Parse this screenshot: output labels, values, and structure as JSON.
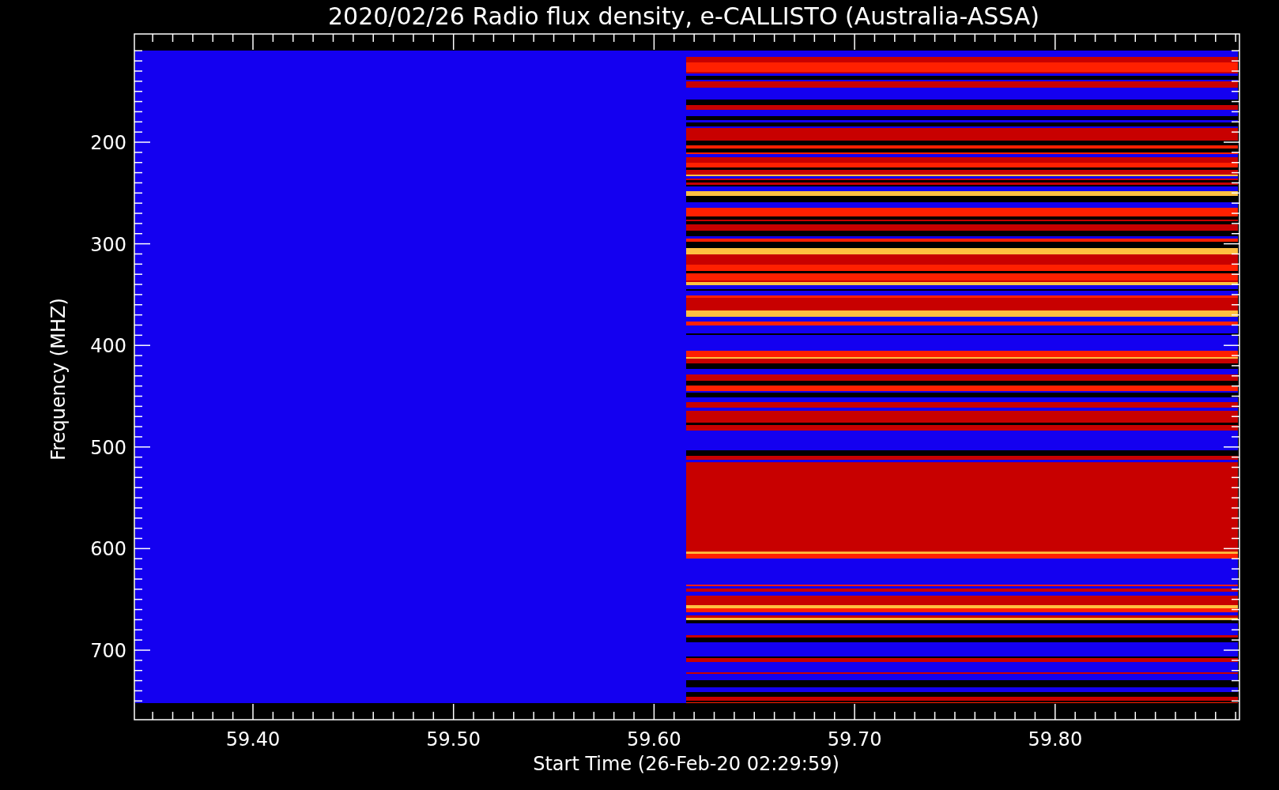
{
  "title": "2020/02/26  Radio flux density, e-CALLISTO (Australia-ASSA)",
  "y_axis": {
    "label": "Frequency (MHZ)",
    "ticks": [
      "200",
      "300",
      "400",
      "500",
      "600",
      "700"
    ]
  },
  "x_axis": {
    "label": "Start Time (26-Feb-20 02:29:59)",
    "ticks": [
      "59.40",
      "59.50",
      "59.60",
      "59.70",
      "59.80"
    ]
  }
}
